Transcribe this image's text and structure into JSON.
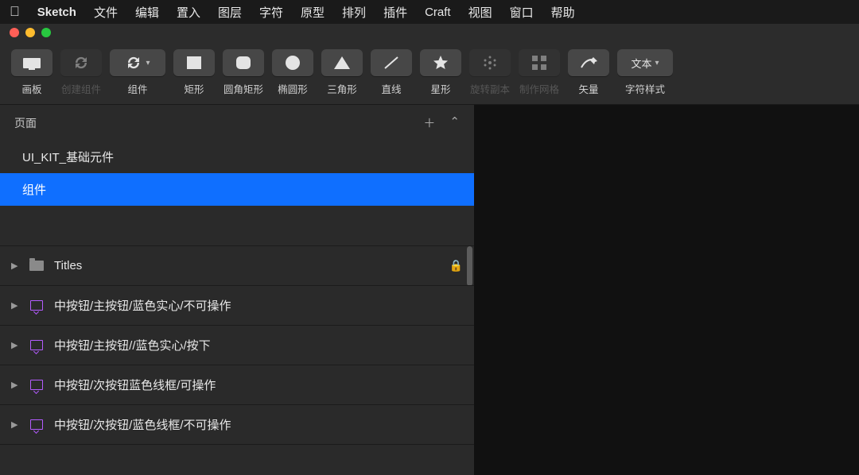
{
  "menubar": {
    "app": "Sketch",
    "items": [
      "文件",
      "编辑",
      "置入",
      "图层",
      "字符",
      "原型",
      "排列",
      "插件",
      "Craft",
      "视图",
      "窗口",
      "帮助"
    ]
  },
  "toolbar": [
    {
      "id": "artboard",
      "label": "画板",
      "icon": "artboard",
      "chev": false,
      "disabled": false
    },
    {
      "id": "create-symbol",
      "label": "创建组件",
      "icon": "sync",
      "chev": false,
      "disabled": true
    },
    {
      "id": "symbol",
      "label": "组件",
      "icon": "sync",
      "chev": true,
      "disabled": false,
      "wide": true
    },
    {
      "id": "rect",
      "label": "矩形",
      "icon": "rect",
      "chev": false,
      "disabled": false
    },
    {
      "id": "roundrect",
      "label": "圆角矩形",
      "icon": "roundrect",
      "chev": false,
      "disabled": false
    },
    {
      "id": "oval",
      "label": "椭圆形",
      "icon": "oval",
      "chev": false,
      "disabled": false
    },
    {
      "id": "triangle",
      "label": "三角形",
      "icon": "triangle",
      "chev": false,
      "disabled": false
    },
    {
      "id": "line",
      "label": "直线",
      "icon": "line",
      "chev": false,
      "disabled": false
    },
    {
      "id": "star",
      "label": "星形",
      "icon": "star",
      "chev": false,
      "disabled": false
    },
    {
      "id": "rotate-copies",
      "label": "旋转副本",
      "icon": "rotate",
      "chev": false,
      "disabled": true
    },
    {
      "id": "make-grid",
      "label": "制作网格",
      "icon": "grid",
      "chev": false,
      "disabled": true
    },
    {
      "id": "vector",
      "label": "矢量",
      "icon": "vector",
      "chev": false,
      "disabled": false
    },
    {
      "id": "text-styles",
      "label": "字符样式",
      "icon": "text",
      "chev": true,
      "disabled": false,
      "wide": true,
      "textLabel": "文本"
    }
  ],
  "pages": {
    "header": "页面",
    "list": [
      {
        "name": "UI_KIT_基础元件",
        "selected": false
      },
      {
        "name": "组件",
        "selected": true
      }
    ]
  },
  "layers": [
    {
      "name": "Titles",
      "icon": "folder",
      "locked": true
    },
    {
      "name": "中按钮/主按钮/蓝色实心/不可操作",
      "icon": "artboard",
      "locked": false
    },
    {
      "name": "中按钮/主按钮//蓝色实心/按下",
      "icon": "artboard",
      "locked": false
    },
    {
      "name": "中按钮/次按钮蓝色线框/可操作",
      "icon": "artboard",
      "locked": false
    },
    {
      "name": "中按钮/次按钮/蓝色线框/不可操作",
      "icon": "artboard",
      "locked": false
    }
  ]
}
